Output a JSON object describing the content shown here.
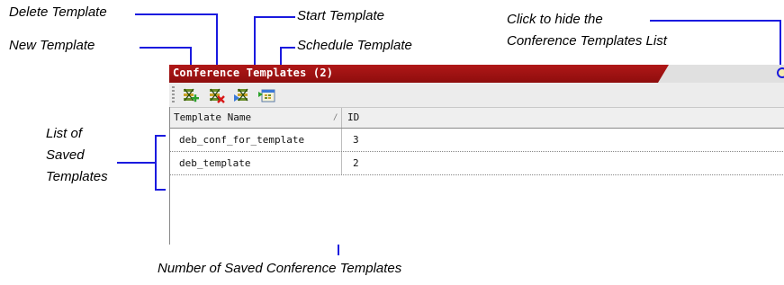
{
  "callouts": {
    "delete_template": "Delete Template",
    "start_template": "Start Template",
    "new_template": "New Template",
    "schedule_template": "Schedule Template",
    "hide_list_line1": "Click to hide the",
    "hide_list_line2": "Conference Templates List",
    "list_saved_line1": "List of",
    "list_saved_line2": "Saved",
    "list_saved_line3": "Templates",
    "number_saved": "Number of Saved Conference Templates"
  },
  "panel": {
    "title": "Conference Templates (2)",
    "toolbar": [
      {
        "icon": "new-template-icon"
      },
      {
        "icon": "delete-template-icon"
      },
      {
        "icon": "start-template-icon"
      },
      {
        "icon": "schedule-template-icon"
      }
    ],
    "columns": [
      "Template Name",
      "ID"
    ],
    "rows": [
      {
        "name": "deb_conf_for_template",
        "id": "3"
      },
      {
        "name": "deb_template",
        "id": "2"
      }
    ]
  },
  "colors": {
    "callout_line": "#1a1adf",
    "title_bar": "#a01212"
  }
}
